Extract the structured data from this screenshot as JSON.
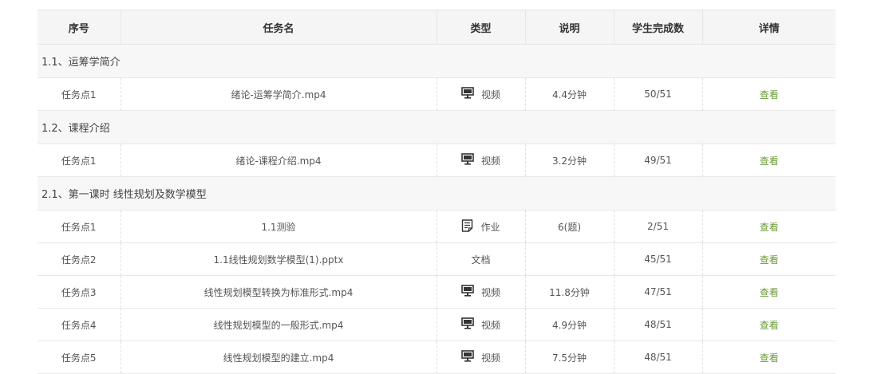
{
  "header": {
    "columns": [
      "序号",
      "任务名",
      "类型",
      "说明",
      "学生完成数",
      "详情"
    ]
  },
  "sections": [
    {
      "title": "1.1、运筹学简介",
      "tasks": [
        {
          "index": "任务点1",
          "name": "绪论-运筹学简介.mp4",
          "icon": "monitor-icon",
          "type": "视频",
          "note": "4.4分钟",
          "completed": "50/51",
          "detail": "查看"
        }
      ]
    },
    {
      "title": "1.2、课程介绍",
      "tasks": [
        {
          "index": "任务点1",
          "name": "绪论-课程介绍.mp4",
          "icon": "monitor-icon",
          "type": "视频",
          "note": "3.2分钟",
          "completed": "49/51",
          "detail": "查看"
        }
      ]
    },
    {
      "title": "2.1、第一课时 线性规划及数学模型",
      "tasks": [
        {
          "index": "任务点1",
          "name": "1.1测验",
          "icon": "document-icon",
          "type": "作业",
          "note": "6(题)",
          "completed": "2/51",
          "detail": "查看"
        },
        {
          "index": "任务点2",
          "name": "1.1线性规划数学模型(1).pptx",
          "icon": "",
          "type": "文档",
          "note": "",
          "completed": "45/51",
          "detail": "查看"
        },
        {
          "index": "任务点3",
          "name": "线性规划模型转换为标准形式.mp4",
          "icon": "monitor-icon",
          "type": "视频",
          "note": "11.8分钟",
          "completed": "47/51",
          "detail": "查看"
        },
        {
          "index": "任务点4",
          "name": "线性规划模型的一般形式.mp4",
          "icon": "monitor-icon",
          "type": "视频",
          "note": "4.9分钟",
          "completed": "48/51",
          "detail": "查看"
        },
        {
          "index": "任务点5",
          "name": "线性规划模型的建立.mp4",
          "icon": "monitor-icon",
          "type": "视频",
          "note": "7.5分钟",
          "completed": "48/51",
          "detail": "查看"
        }
      ]
    }
  ],
  "colors": {
    "link": "#6b9a3a",
    "header_bg": "#f5f5f5",
    "section_bg": "#f7f7f7"
  }
}
